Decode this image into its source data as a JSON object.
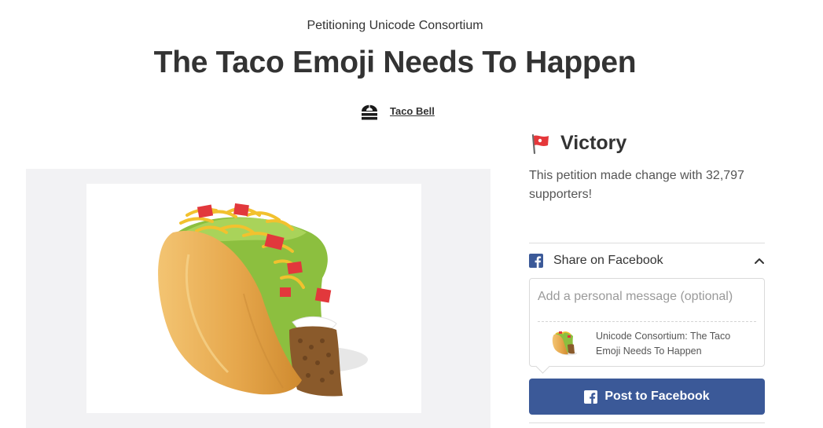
{
  "header": {
    "petitioning": "Petitioning Unicode Consortium",
    "title": "The Taco Emoji Needs To Happen"
  },
  "starter": {
    "name": "Taco Bell",
    "logo_icon": "taco-bell-logo-icon"
  },
  "victory": {
    "icon": "victory-flag-icon",
    "title": "Victory",
    "text": "This petition made change with 32,797 supporters!",
    "supporters": 32797
  },
  "share": {
    "icon": "facebook-icon",
    "label": "Share on Facebook",
    "expanded": true,
    "message_placeholder": "Add a personal message (optional)",
    "message_value": "",
    "preview_title": "Unicode Consortium: The Taco Emoji Needs To Happen",
    "post_label": "Post to Facebook"
  },
  "colors": {
    "facebook_blue": "#3b5998",
    "victory_red": "#e5373a",
    "text": "#333333",
    "media_bg": "#f2f2f4"
  }
}
